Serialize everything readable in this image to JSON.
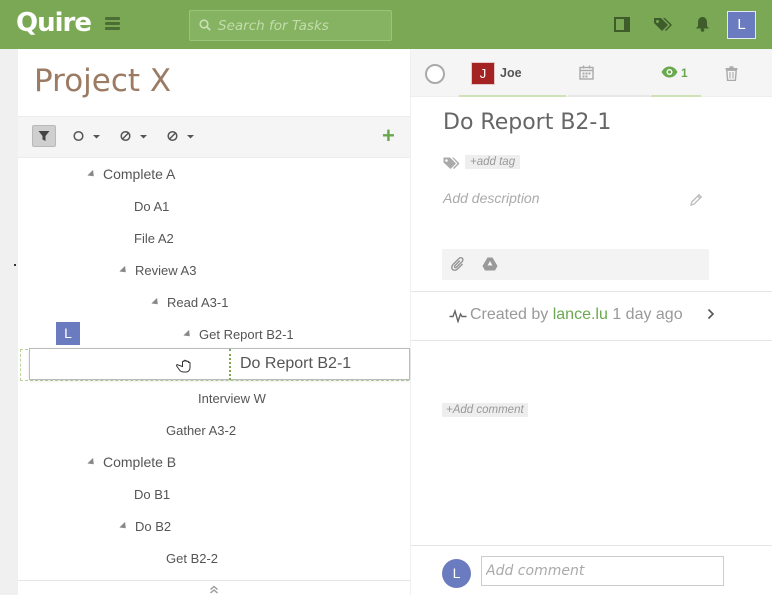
{
  "app": {
    "logo": "Quire"
  },
  "search": {
    "placeholder": "Search for Tasks"
  },
  "user": {
    "initial": "L"
  },
  "project": {
    "title": "Project X"
  },
  "tasks": [
    {
      "label": "Complete A",
      "collapsible": true
    },
    {
      "label": "Do A1",
      "collapsible": false
    },
    {
      "label": "File A2",
      "collapsible": false
    },
    {
      "label": "Review A3",
      "collapsible": true
    },
    {
      "label": "Read A3-1",
      "collapsible": true
    },
    {
      "label": "Get Report B2-1",
      "collapsible": true
    },
    {
      "label": "Interview W",
      "collapsible": false
    },
    {
      "label": "Gather A3-2",
      "collapsible": false
    },
    {
      "label": "Complete B",
      "collapsible": true
    },
    {
      "label": "Do B1",
      "collapsible": false
    },
    {
      "label": "Do B2",
      "collapsible": true
    },
    {
      "label": "Get B2-2",
      "collapsible": false
    }
  ],
  "dragging": {
    "label": "Do Report B2-1",
    "avatar_initial": "L"
  },
  "detail": {
    "title": "Do Report B2-1",
    "assignee_initial": "J",
    "assignee_name": "Joe",
    "follower_count": "1",
    "add_tag": "+add tag",
    "add_description": "Add description",
    "activity_prefix": "Created by ",
    "activity_user": "lance.lu",
    "activity_suffix": " 1 day ago",
    "add_comment_link": "+Add comment",
    "comment_avatar": "L",
    "comment_placeholder": "Add comment"
  },
  "colors": {
    "brand_green": "#7aa855",
    "avatar_blue": "#6b7bbf",
    "assignee_red": "#a52222",
    "title_brown": "#9b7b63"
  }
}
